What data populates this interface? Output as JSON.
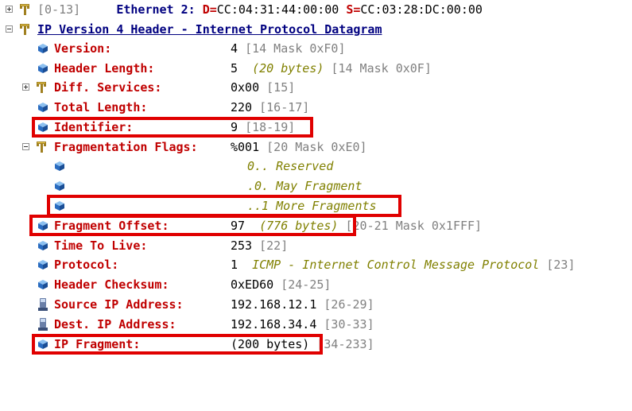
{
  "ethernet": {
    "range": "[0-13]",
    "title": "Ethernet 2:",
    "d_label": "D=",
    "d_value": "CC:04:31:44:00:00",
    "s_label": "S=",
    "s_value": "CC:03:28:DC:00:00"
  },
  "ip_header": {
    "title": "IP Version 4 Header - Internet Protocol Datagram"
  },
  "fields": {
    "version": {
      "label": "Version:",
      "value": "4",
      "range": "[14 Mask 0xF0]"
    },
    "header_length": {
      "label": "Header Length:",
      "value": "5",
      "note": "(20 bytes)",
      "range": "[14 Mask 0x0F]"
    },
    "diff_services": {
      "label": "Diff. Services:",
      "value": "0x00",
      "range": "[15]"
    },
    "total_length": {
      "label": "Total Length:",
      "value": "220",
      "range": "[16-17]"
    },
    "identifier": {
      "label": "Identifier:",
      "value": "9",
      "range": "[18-19]"
    },
    "frag_flags": {
      "label": "Fragmentation Flags:",
      "value": "%001",
      "range": "[20 Mask 0xE0]"
    },
    "flag_reserved": "0.. Reserved",
    "flag_may_fragment": ".0. May Fragment",
    "flag_more_fragments": "..1 More Fragments",
    "fragment_offset": {
      "label": "Fragment Offset:",
      "value": "97",
      "note": "(776 bytes)",
      "range": "[20-21 Mask 0x1FFF]"
    },
    "ttl": {
      "label": "Time To Live:",
      "value": "253",
      "range": "[22]"
    },
    "protocol": {
      "label": "Protocol:",
      "value": "1",
      "note": "ICMP - Internet Control Message Protocol",
      "range": "[23]"
    },
    "checksum": {
      "label": "Header Checksum:",
      "value": "0xED60",
      "range": "[24-25]"
    },
    "src_ip": {
      "label": "Source IP Address:",
      "value": "192.168.12.1",
      "range": "[26-29]"
    },
    "dst_ip": {
      "label": "Dest. IP Address:",
      "value": "192.168.34.4",
      "range": "[30-33]"
    },
    "ip_fragment": {
      "label": "IP Fragment:",
      "value": "(200 bytes)",
      "range": "[34-233]"
    }
  },
  "colors": {
    "label_red": "#c00000",
    "title_navy": "#000080",
    "range_gray": "#808080",
    "note_olive": "#808000",
    "highlight": "#e00000"
  }
}
